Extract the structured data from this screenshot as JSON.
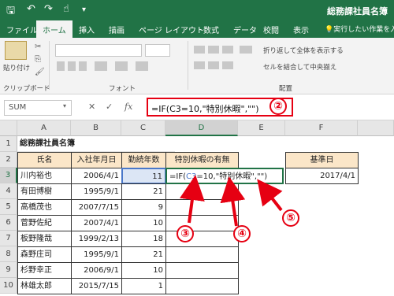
{
  "window": {
    "title": "総務課社員名簿"
  },
  "ribbon_tabs": [
    "ファイル",
    "ホーム",
    "挿入",
    "描画",
    "ページ レイアウト",
    "数式",
    "データ",
    "校閲",
    "表示",
    "実行したい作業を入力してください"
  ],
  "ribbon": {
    "paste": "貼り付け",
    "clipboard": "クリップボード",
    "font": "フォント",
    "align": "配置",
    "wrap": "折り返して全体を表示する",
    "merge": "セルを結合して中央揃え"
  },
  "formula_bar": {
    "name_box": "SUM",
    "fx": "fx",
    "formula": "=IF(C3=10,\"特別休暇\",\"\")"
  },
  "columns": [
    "A",
    "B",
    "C",
    "D",
    "E",
    "F"
  ],
  "sheet": {
    "title": "総務課社員名簿",
    "headers": {
      "name": "氏名",
      "joined": "入社年月日",
      "years": "勤続年数",
      "leave": "特別休暇の有無"
    },
    "rows": [
      {
        "num": "3",
        "name": "川内裕也",
        "joined": "2006/4/1",
        "years": "11"
      },
      {
        "num": "4",
        "name": "有田博樹",
        "joined": "1995/9/1",
        "years": "21"
      },
      {
        "num": "5",
        "name": "高橋茂也",
        "joined": "2007/7/15",
        "years": "9"
      },
      {
        "num": "6",
        "name": "菅野佐紀",
        "joined": "2007/4/1",
        "years": "10"
      },
      {
        "num": "7",
        "name": "板野隆哉",
        "joined": "1999/2/13",
        "years": "18"
      },
      {
        "num": "8",
        "name": "森野庄司",
        "joined": "1995/9/1",
        "years": "21"
      },
      {
        "num": "9",
        "name": "杉野幸正",
        "joined": "2006/9/1",
        "years": "10"
      },
      {
        "num": "10",
        "name": "林雄太郎",
        "joined": "2015/7/15",
        "years": "1"
      }
    ],
    "editing": {
      "p1": "=IF(",
      "p2": "C3",
      "p3": "=10,\"特別休暇\",\"\")"
    },
    "base_label": "基準日",
    "base_date": "2017/4/1"
  },
  "annotations": [
    "②",
    "③",
    "④",
    "⑤"
  ],
  "colors": {
    "excel_green": "#217346",
    "annotation_red": "#e60012",
    "header_fill": "#fbe6c8"
  }
}
